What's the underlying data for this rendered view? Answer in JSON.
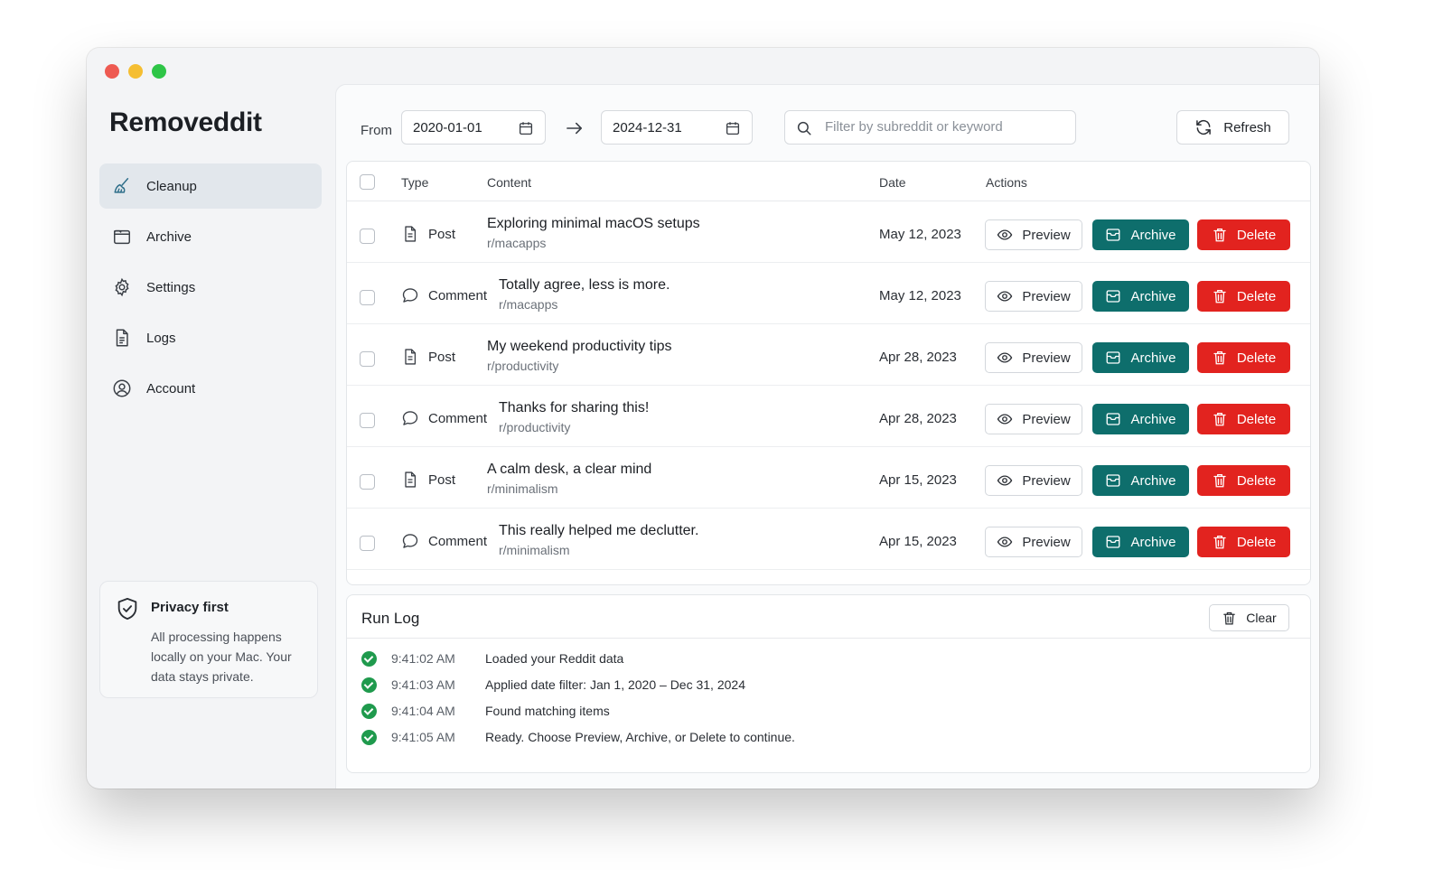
{
  "app": {
    "title": "Removeddit"
  },
  "sidebar": {
    "items": [
      {
        "label": "Cleanup",
        "icon": "broom-icon",
        "active": true
      },
      {
        "label": "Archive",
        "icon": "folder-icon",
        "active": false
      },
      {
        "label": "Settings",
        "icon": "gear-icon",
        "active": false
      },
      {
        "label": "Logs",
        "icon": "document-icon",
        "active": false
      },
      {
        "label": "Account",
        "icon": "user-circle-icon",
        "active": false
      }
    ],
    "privacy": {
      "title": "Privacy first",
      "text": "All processing happens locally on your Mac. Your data stays private."
    }
  },
  "toolbar": {
    "from_label": "From",
    "from_date": "2020-01-01",
    "to_date": "2024-12-31",
    "search_placeholder": "Filter by subreddit or keyword",
    "refresh_label": "Refresh"
  },
  "table": {
    "headers": {
      "type": "Type",
      "content": "Content",
      "date": "Date",
      "actions": "Actions"
    },
    "action_labels": {
      "preview": "Preview",
      "archive": "Archive",
      "delete": "Delete"
    },
    "rows": [
      {
        "type": "Post",
        "title": "Exploring minimal macOS setups",
        "subreddit": "r/macapps",
        "date": "May 12, 2023"
      },
      {
        "type": "Comment",
        "title": "Totally agree, less is more.",
        "subreddit": "r/macapps",
        "date": "May 12, 2023"
      },
      {
        "type": "Post",
        "title": "My weekend productivity tips",
        "subreddit": "r/productivity",
        "date": "Apr 28, 2023"
      },
      {
        "type": "Comment",
        "title": "Thanks for sharing this!",
        "subreddit": "r/productivity",
        "date": "Apr 28, 2023"
      },
      {
        "type": "Post",
        "title": "A calm desk, a clear mind",
        "subreddit": "r/minimalism",
        "date": "Apr 15, 2023"
      },
      {
        "type": "Comment",
        "title": "This really helped me declutter.",
        "subreddit": "r/minimalism",
        "date": "Apr 15, 2023"
      }
    ]
  },
  "runlog": {
    "title": "Run Log",
    "clear_label": "Clear",
    "entries": [
      {
        "time": "9:41:02 AM",
        "message": "Loaded your Reddit data"
      },
      {
        "time": "9:41:03 AM",
        "message": "Applied date filter: Jan 1, 2020 – Dec 31, 2024"
      },
      {
        "time": "9:41:04 AM",
        "message": "Found matching items"
      },
      {
        "time": "9:41:05 AM",
        "message": "Ready. Choose Preview, Archive, or Delete to continue."
      }
    ]
  },
  "colors": {
    "archive": "#0e6e6c",
    "delete": "#e2231f",
    "success": "#1f9a4d",
    "active_nav": "#e2e7ec"
  }
}
